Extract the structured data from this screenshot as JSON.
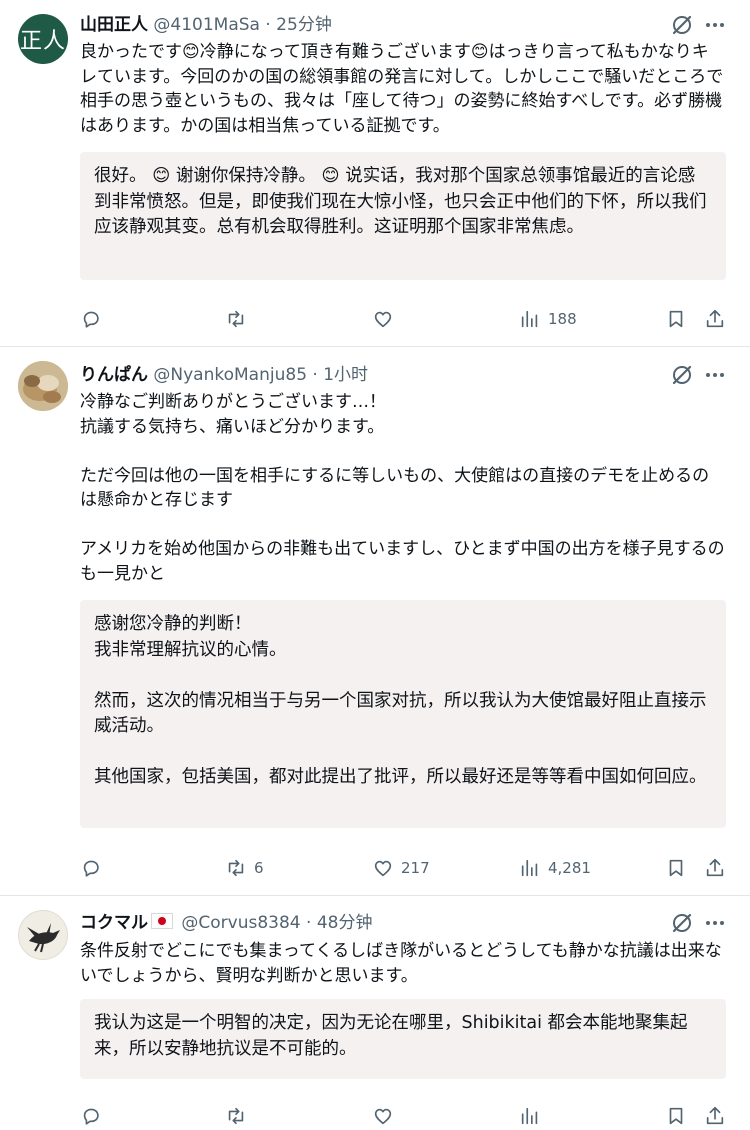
{
  "posts": [
    {
      "avatar_text": "正人",
      "name": "山田正人",
      "flag": false,
      "handle": "@4101MaSa",
      "time": "· 25分钟",
      "text": "良かったです😊冷静になって頂き有難うございます😊はっきり言って私もかなりキレています。今回のかの国の総領事館の発言に対して。しかしここで騒いだところで相手の思う壺というもの、我々は「座して待つ」の姿勢に終始すべしです。必ず勝機はあります。かの国は相当焦っている証拠です。",
      "translation": "很好。 😊 谢谢你保持冷静。 😊 说实话，我对那个国家总领事馆最近的言论感到非常愤怒。但是，即使我们现在大惊小怪，也只会正中他们的下怀，所以我们应该静观其变。总有机会取得胜利。这证明那个国家非常焦虑。",
      "replies": "",
      "reposts": "",
      "likes": "",
      "views": "188"
    },
    {
      "avatar_text": "",
      "name": "りんぱん",
      "flag": false,
      "handle": "@NyankoManju85",
      "time": "· 1小时",
      "text": "冷静なご判断ありがとうございます…！\n抗議する気持ち、痛いほど分かります。\n\nただ今回は他の一国を相手にするに等しいもの、大使館はの直接のデモを止めるのは懸命かと存じます\n\nアメリカを始め他国からの非難も出ていますし、ひとまず中国の出方を様子見するのも一見かと",
      "translation": "感谢您冷静的判断！\n我非常理解抗议的心情。\n\n然而，这次的情况相当于与另一个国家对抗，所以我认为大使馆最好阻止直接示威活动。\n\n其他国家，包括美国，都对此提出了批评，所以最好还是等等看中国如何回应。",
      "replies": "",
      "reposts": "6",
      "likes": "217",
      "views": "4,281"
    },
    {
      "avatar_text": "",
      "name": "コクマル",
      "flag": true,
      "handle": "@Corvus8384",
      "time": "· 48分钟",
      "text": "条件反射でどこにでも集まってくるしばき隊がいるとどうしても静かな抗議は出来ないでしょうから、賢明な判断かと思います。",
      "translation": "我认为这是一个明智的决定，因为无论在哪里，Shibikitai 都会本能地聚集起来，所以安静地抗议是不可能的。",
      "replies": "",
      "reposts": "",
      "likes": "",
      "views": ""
    }
  ],
  "icons": {
    "top_right": [
      "grok-icon",
      "more-icon"
    ],
    "actions": [
      "reply-icon",
      "repost-icon",
      "like-icon",
      "views-icon",
      "bookmark-icon",
      "share-icon"
    ]
  },
  "colors": {
    "text": "#0f1419",
    "secondary": "#536471",
    "translation_bg": "#f6f1f1",
    "avatar1_bg": "#1e5a46"
  }
}
